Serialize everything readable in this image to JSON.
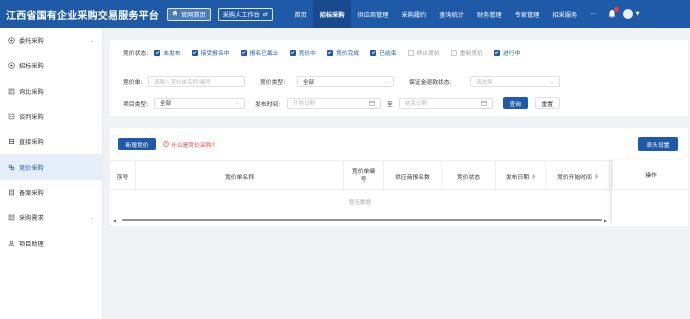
{
  "header": {
    "brand": "江西省国有企业采购交易服务平台",
    "home_label": "官网首页",
    "workbench_label": "采购人工作台",
    "nav": [
      "首页",
      "招标采购",
      "供应商管理",
      "采购履约",
      "查询统计",
      "财务管理",
      "专家管理",
      "招采服务",
      "···"
    ],
    "active_nav_index": 1
  },
  "sidebar": {
    "items": [
      {
        "label": "委托采购",
        "icon": "delegate-icon",
        "has_arrow": true
      },
      {
        "label": "招标采购",
        "icon": "tender-icon"
      },
      {
        "label": "询比采购",
        "icon": "inquiry-icon"
      },
      {
        "label": "谈判采购",
        "icon": "negotiation-icon"
      },
      {
        "label": "直接采购",
        "icon": "direct-icon"
      },
      {
        "label": "竞价采购",
        "icon": "bidding-icon",
        "active": true
      },
      {
        "label": "备案采购",
        "icon": "record-icon"
      },
      {
        "label": "采购需求",
        "icon": "demand-icon",
        "has_arrow": true
      },
      {
        "label": "项目助理",
        "icon": "assistant-icon"
      }
    ]
  },
  "filters": {
    "status_label": "竞价状态:",
    "statuses": [
      {
        "label": "未发布",
        "checked": true
      },
      {
        "label": "接受报名中",
        "checked": true
      },
      {
        "label": "报名已截止",
        "checked": true
      },
      {
        "label": "竞价中",
        "checked": true
      },
      {
        "label": "竞价完成",
        "checked": true
      },
      {
        "label": "已结束",
        "checked": true
      },
      {
        "label": "终止竞价",
        "checked": false
      },
      {
        "label": "重新竞价",
        "checked": false
      },
      {
        "label": "进行中",
        "checked": true
      }
    ],
    "bid_no_label": "竞价单:",
    "bid_no_placeholder": "请输入竞价单名称/编号",
    "bid_type_label": "竞价类型:",
    "bid_type_value": "全部",
    "deposit_label": "保证金退款状态:",
    "deposit_placeholder": "请选择",
    "project_type_label": "项目类型:",
    "project_type_value": "全部",
    "publish_time_label": "发布时间:",
    "start_placeholder": "开始日期",
    "to_label": "至",
    "end_placeholder": "结束日期",
    "search_label": "查询",
    "reset_label": "重置"
  },
  "table": {
    "new_button": "新增竞价",
    "help_text": "什么是竞价采购?",
    "columns_button": "表头设置",
    "columns": [
      "序号",
      "竞价单名称",
      "竞价单编号",
      "供应商报名数",
      "竞价状态",
      "发布日期",
      "竞价开始时间",
      "操作"
    ],
    "empty_text": "暂无数据"
  },
  "colors": {
    "primary": "#1f5aa8",
    "header_active": "#174a8e",
    "danger": "#e44444"
  }
}
